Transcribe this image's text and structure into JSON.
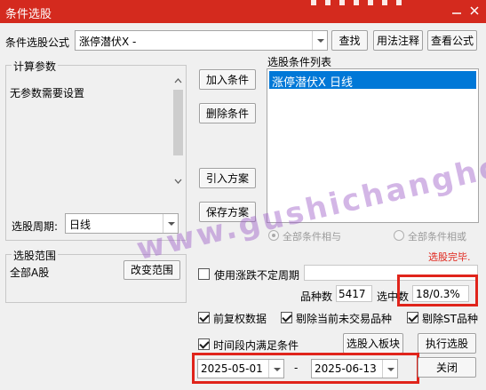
{
  "window": {
    "title": "条件选股",
    "minimize_glyph": "—",
    "close_glyph": "✕"
  },
  "formula": {
    "label": "条件选股公式",
    "value": "涨停潜伏X  -",
    "find_button": "查找",
    "usage_button": "用法注释",
    "view_button": "查看公式"
  },
  "params": {
    "group_title": "计算参数",
    "text": "无参数需要设置",
    "period_label": "选股周期:",
    "period_value": "日线"
  },
  "actions": {
    "add": "加入条件",
    "remove": "删除条件",
    "import": "引入方案",
    "save": "保存方案"
  },
  "conditions": {
    "title": "选股条件列表",
    "items": [
      "涨停潜伏X  日线"
    ],
    "radio_and": "全部条件相与",
    "radio_or": "全部条件相或",
    "status": "选股完毕."
  },
  "scope": {
    "group_title": "选股范围",
    "value": "全部A股",
    "change_button": "改变范围"
  },
  "options": {
    "variable_period": "使用涨跌不定周期",
    "count_label": "品种数",
    "count_value": "5417",
    "selected_label": "选中数",
    "selected_value": "18/0.3%",
    "fq": "前复权数据",
    "exclude_non_trading": "剔除当前未交易品种",
    "exclude_st": "剔除ST品种",
    "time_range": "时间段内满足条件",
    "to_board_button": "选股入板块",
    "run_button": "执行选股",
    "start_date": "2025-05-01",
    "date_sep": "-",
    "end_date": "2025-06-13",
    "close_button": "关闭"
  },
  "watermark": "www.gushichanghong.com",
  "colors": {
    "titlebar": "#d42a1e",
    "selection": "#0078d7",
    "status_red": "#e0241b",
    "highlight_box": "#e0241b"
  }
}
